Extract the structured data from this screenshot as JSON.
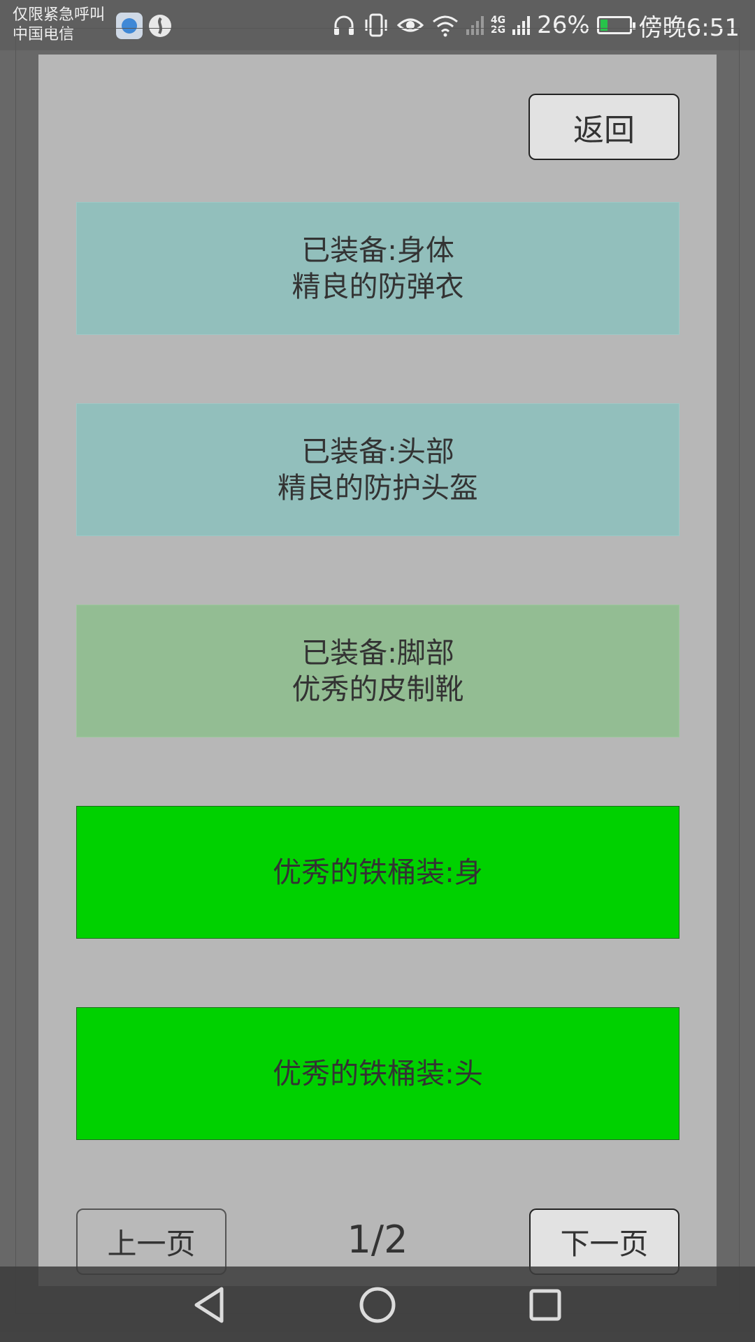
{
  "status_bar": {
    "carrier_line1": "仅限紧急呼叫",
    "carrier_line2": "中国电信",
    "network_label_top": "4G",
    "network_label_bottom": "2G",
    "battery_percent": "26%",
    "battery_level": 0.26,
    "time": "傍晚6:51"
  },
  "dialog": {
    "back_label": "返回",
    "slots": [
      {
        "line1": "已装备:身体",
        "line2": "精良的防弹衣",
        "color": "#92bfbc"
      },
      {
        "line1": "已装备:头部",
        "line2": "精良的防护头盔",
        "color": "#92bfbc"
      },
      {
        "line1": "已装备:脚部",
        "line2": "优秀的皮制靴",
        "color": "#93bd93"
      },
      {
        "line1": "优秀的铁桶装:身",
        "color": "#00d100"
      },
      {
        "line1": "优秀的铁桶装:头",
        "color": "#00d100"
      }
    ],
    "prev_label": "上一页",
    "page_indicator": "1/2",
    "next_label": "下一页"
  },
  "nav_bar": {
    "icons": [
      "back-triangle-icon",
      "home-circle-icon",
      "recents-square-icon"
    ]
  }
}
